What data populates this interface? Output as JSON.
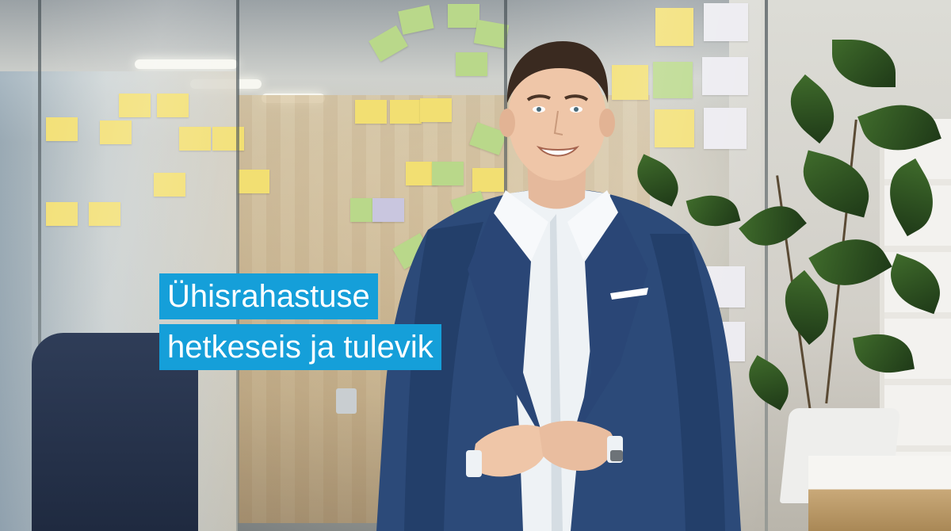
{
  "overlay": {
    "title_lines": [
      "Ühisrahastuse",
      "hetkeseis ja tulevik"
    ],
    "highlight_color": "#159fd9",
    "text_color": "#ffffff"
  },
  "colors": {
    "jacket": "#2c4a79",
    "shirt": "#eef2f5",
    "plant": "#2f5423"
  }
}
